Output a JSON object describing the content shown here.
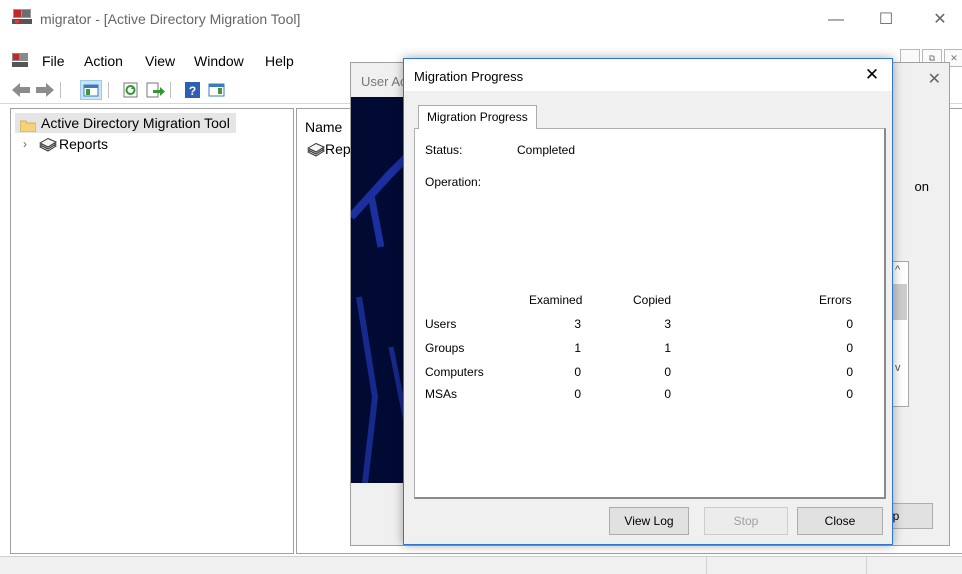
{
  "window": {
    "title": "migrator - [Active Directory Migration Tool]",
    "minimize_glyph": "—",
    "maximize_glyph": "☐",
    "close_glyph": "✕"
  },
  "menu": {
    "items": [
      "File",
      "Action",
      "View",
      "Window",
      "Help"
    ]
  },
  "mdi_controls": {
    "min": "_",
    "restore": "⧉",
    "close": "✕"
  },
  "toolbar": {
    "icons": [
      "back-icon",
      "forward-icon",
      "show-hide-tree-icon",
      "refresh-icon",
      "export-list-icon",
      "help-icon",
      "show-hide-action-pane-icon"
    ]
  },
  "tree": {
    "root_label": "Active Directory Migration Tool",
    "child_label": "Reports",
    "expander_glyph": "›"
  },
  "result": {
    "column_header": "Name",
    "item_label": "Reports"
  },
  "wizard": {
    "title": "User Account Migration Wizard",
    "close_glyph": "✕",
    "text_fragment": "on",
    "button_fragment": "lp",
    "scroll_up": "^",
    "scroll_down": "v"
  },
  "dialog": {
    "title": "Migration Progress",
    "close_glyph": "✕",
    "tab_label": "Migration Progress",
    "status_label": "Status:",
    "status_value": "Completed",
    "operation_label": "Operation:",
    "operation_value": "",
    "columns": [
      "Examined",
      "Copied",
      "Errors"
    ],
    "rows": [
      {
        "label": "Users",
        "examined": "3",
        "copied": "3",
        "errors": "0"
      },
      {
        "label": "Groups",
        "examined": "1",
        "copied": "1",
        "errors": "0"
      },
      {
        "label": "Computers",
        "examined": "0",
        "copied": "0",
        "errors": "0"
      },
      {
        "label": "MSAs",
        "examined": "0",
        "copied": "0",
        "errors": "0"
      }
    ],
    "buttons": {
      "view_log": "View Log",
      "stop": "Stop",
      "close": "Close"
    }
  },
  "colors": {
    "dialog_border": "#2b78d6",
    "wizard_art": "#000a33",
    "tree_selection": "#e5e5e5"
  }
}
